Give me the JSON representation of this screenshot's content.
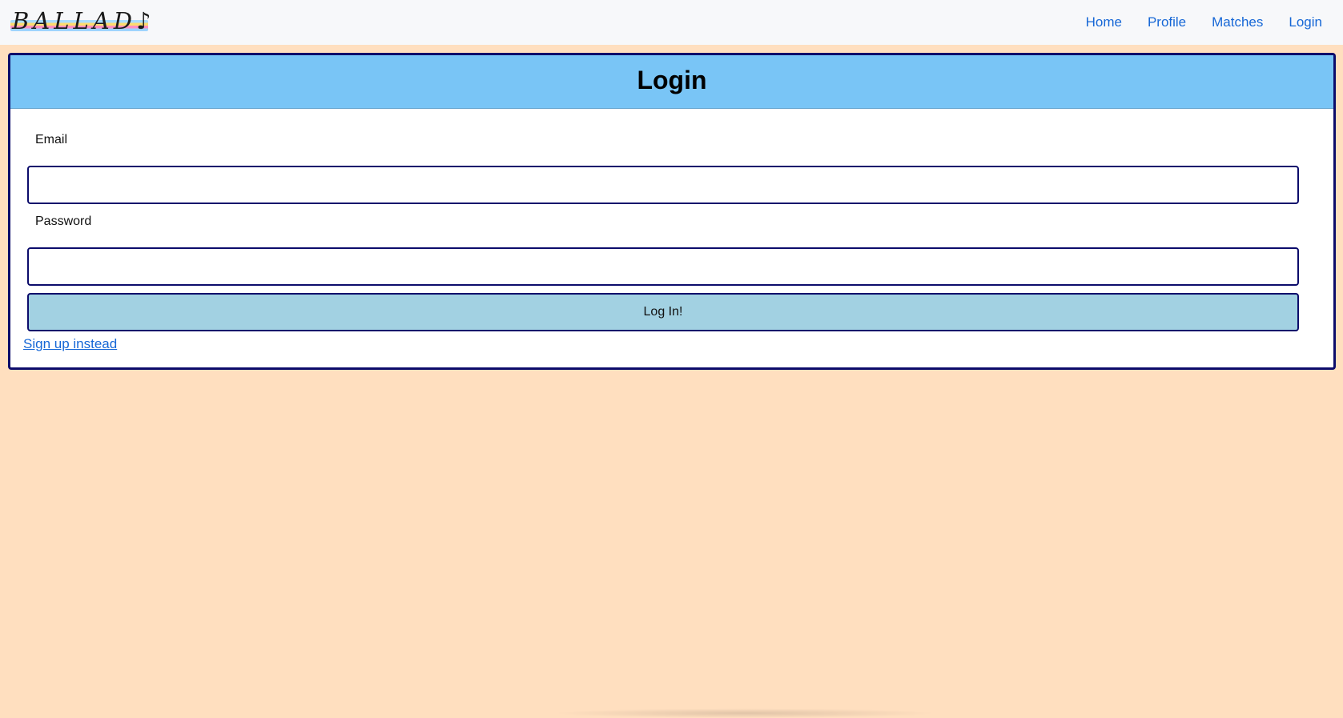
{
  "navbar": {
    "brand": "BALLAD♪",
    "links": [
      {
        "label": "Home"
      },
      {
        "label": "Profile"
      },
      {
        "label": "Matches"
      },
      {
        "label": "Login"
      }
    ]
  },
  "card": {
    "title": "Login",
    "email_label": "Email",
    "email_value": "",
    "password_label": "Password",
    "password_value": "",
    "submit_label": "Log In!",
    "signup_link": "Sign up instead"
  },
  "colors": {
    "page_background": "#ffdfbf",
    "header_background": "#79c5f6",
    "border": "#0c0c6b",
    "button_background": "#a2d1e2",
    "link": "#1667d6"
  }
}
